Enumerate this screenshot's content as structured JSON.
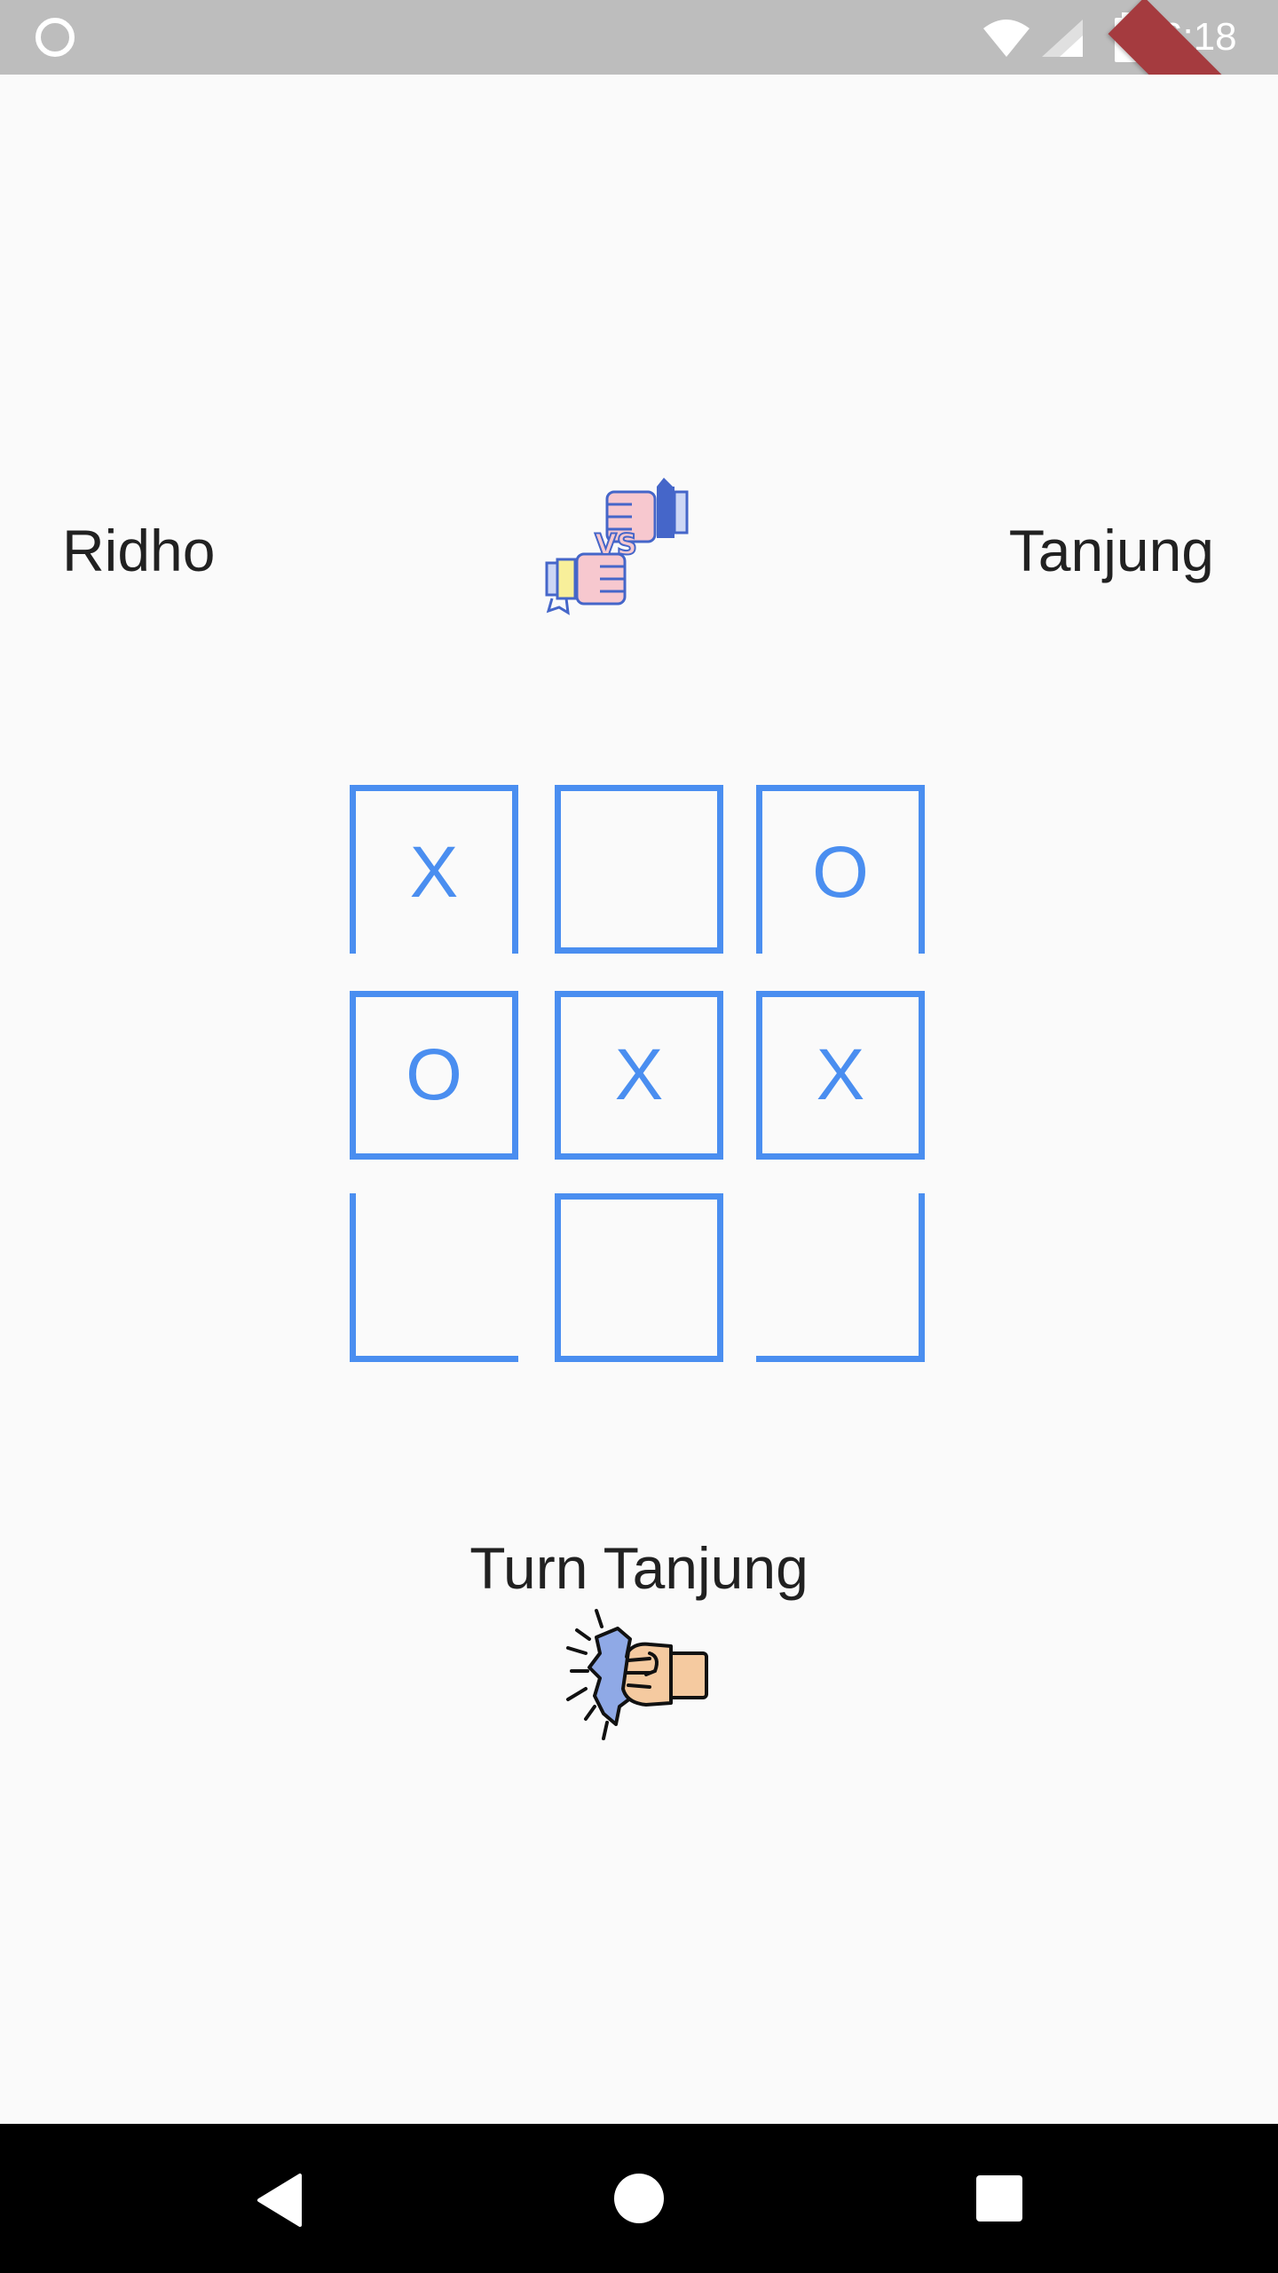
{
  "status_bar": {
    "time": "6:18",
    "left_icon": "circle-notification-icon",
    "wifi_icon": "wifi-icon",
    "signal_icon": "cell-signal-icon",
    "battery_icon": "battery-icon",
    "debug_banner": "DEBUG",
    "background_color": "#bdbdbd",
    "banner_color": "#a53b3f"
  },
  "players": {
    "left_name": "Ridho",
    "right_name": "Tanjung",
    "versus_icon": "versus-fists-icon"
  },
  "board": {
    "accent_color": "#4a8ef0",
    "cells": [
      {
        "index": 0,
        "value": "X"
      },
      {
        "index": 1,
        "value": ""
      },
      {
        "index": 2,
        "value": "O"
      },
      {
        "index": 3,
        "value": "O"
      },
      {
        "index": 4,
        "value": "X"
      },
      {
        "index": 5,
        "value": "X"
      },
      {
        "index": 6,
        "value": ""
      },
      {
        "index": 7,
        "value": ""
      },
      {
        "index": 8,
        "value": ""
      }
    ]
  },
  "turn": {
    "label": "Turn Tanjung",
    "icon": "punch-fist-icon"
  },
  "nav_bar": {
    "back_icon": "back-triangle-icon",
    "home_icon": "home-circle-icon",
    "recent_icon": "recent-apps-square-icon"
  }
}
